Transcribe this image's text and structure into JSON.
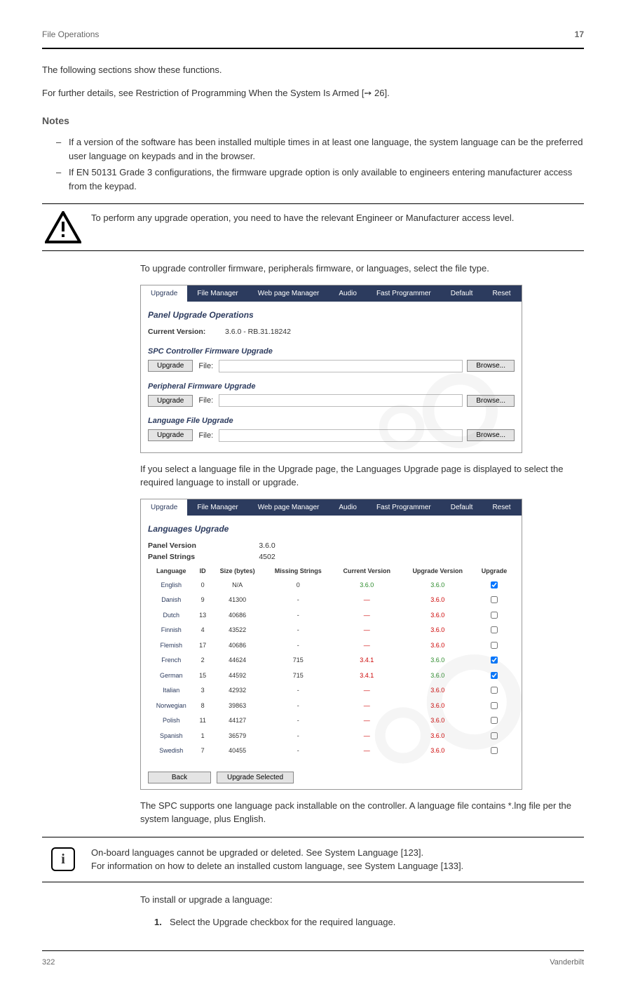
{
  "header": {
    "left": "File Operations",
    "right": "17"
  },
  "footer": {
    "left": "322",
    "right": "Vanderbilt"
  },
  "intro": {
    "line1": "The following sections show these functions.",
    "line2": "For further details, see Restriction of Programming When the System Is Armed [➙ 26]."
  },
  "noteSectionTitle": "Notes",
  "bullets": [
    "If a version of the software has been installed multiple times in at least one language, the system language can be the preferred user language on keypads and in the browser.",
    "If EN 50131 Grade 3 configurations, the firmware upgrade option is only available to engineers entering manufacturer access from the keypad."
  ],
  "warning": "To perform any upgrade operation, you need to have the relevant Engineer or Manufacturer access level.",
  "figure1_intro": "To upgrade controller firmware, peripherals firmware, or languages, select the file type.",
  "figure2_intro": "If you select a language file in the Upgrade page, the Languages Upgrade page is displayed to select the required language to install or upgrade.",
  "fig1": {
    "tabs": [
      "Upgrade",
      "File Manager",
      "Web page Manager",
      "Audio",
      "Fast Programmer",
      "Default",
      "Reset"
    ],
    "title": "Panel Upgrade Operations",
    "current_version_label": "Current Version:",
    "current_version_value": "3.6.0 - RB.31.18242",
    "sections": [
      {
        "title": "SPC Controller Firmware Upgrade",
        "btn": "Upgrade",
        "file": "File:",
        "browse": "Browse..."
      },
      {
        "title": "Peripheral Firmware Upgrade",
        "btn": "Upgrade",
        "file": "File:",
        "browse": "Browse..."
      },
      {
        "title": "Language File Upgrade",
        "btn": "Upgrade",
        "file": "File:",
        "browse": "Browse..."
      }
    ]
  },
  "fig2": {
    "tabs": [
      "Upgrade",
      "File Manager",
      "Web page Manager",
      "Audio",
      "Fast Programmer",
      "Default",
      "Reset"
    ],
    "title": "Languages Upgrade",
    "panel_version_label": "Panel Version",
    "panel_version_value": "3.6.0",
    "panel_strings_label": "Panel Strings",
    "panel_strings_value": "4502",
    "headers": [
      "Language",
      "ID",
      "Size (bytes)",
      "Missing Strings",
      "Current Version",
      "Upgrade Version",
      "Upgrade"
    ],
    "rows": [
      {
        "lang": "English",
        "id": "0",
        "size": "N/A",
        "missing": "0",
        "current": "3.6.0",
        "upgrade": "3.6.0",
        "chk": true,
        "cc": "green",
        "uc": "green"
      },
      {
        "lang": "Danish",
        "id": "9",
        "size": "41300",
        "missing": "-",
        "current": "—",
        "upgrade": "3.6.0",
        "chk": false,
        "cc": "red",
        "uc": "red"
      },
      {
        "lang": "Dutch",
        "id": "13",
        "size": "40686",
        "missing": "-",
        "current": "—",
        "upgrade": "3.6.0",
        "chk": false,
        "cc": "red",
        "uc": "red"
      },
      {
        "lang": "Finnish",
        "id": "4",
        "size": "43522",
        "missing": "-",
        "current": "—",
        "upgrade": "3.6.0",
        "chk": false,
        "cc": "red",
        "uc": "red"
      },
      {
        "lang": "Flemish",
        "id": "17",
        "size": "40686",
        "missing": "-",
        "current": "—",
        "upgrade": "3.6.0",
        "chk": false,
        "cc": "red",
        "uc": "red"
      },
      {
        "lang": "French",
        "id": "2",
        "size": "44624",
        "missing": "715",
        "current": "3.4.1",
        "upgrade": "3.6.0",
        "chk": true,
        "cc": "red",
        "uc": "green"
      },
      {
        "lang": "German",
        "id": "15",
        "size": "44592",
        "missing": "715",
        "current": "3.4.1",
        "upgrade": "3.6.0",
        "chk": true,
        "cc": "red",
        "uc": "green"
      },
      {
        "lang": "Italian",
        "id": "3",
        "size": "42932",
        "missing": "-",
        "current": "—",
        "upgrade": "3.6.0",
        "chk": false,
        "cc": "red",
        "uc": "red"
      },
      {
        "lang": "Norwegian",
        "id": "8",
        "size": "39863",
        "missing": "-",
        "current": "—",
        "upgrade": "3.6.0",
        "chk": false,
        "cc": "red",
        "uc": "red"
      },
      {
        "lang": "Polish",
        "id": "11",
        "size": "44127",
        "missing": "-",
        "current": "—",
        "upgrade": "3.6.0",
        "chk": false,
        "cc": "red",
        "uc": "red"
      },
      {
        "lang": "Spanish",
        "id": "1",
        "size": "36579",
        "missing": "-",
        "current": "—",
        "upgrade": "3.6.0",
        "chk": false,
        "cc": "red",
        "uc": "red"
      },
      {
        "lang": "Swedish",
        "id": "7",
        "size": "40455",
        "missing": "-",
        "current": "—",
        "upgrade": "3.6.0",
        "chk": false,
        "cc": "red",
        "uc": "red"
      }
    ],
    "back_btn": "Back",
    "upgrade_selected_btn": "Upgrade Selected"
  },
  "below2": "The SPC supports one language pack installable on the controller. A language file contains *.lng file per the system language, plus English.",
  "infoNote": {
    "line1": "On-board languages cannot be upgraded or deleted. See System Language [123].",
    "line2": "For information on how to delete an installed custom language, see System Language [133]."
  },
  "steps_intro": "To install or upgrade a language:",
  "steps": [
    "Select the Upgrade checkbox for the required language."
  ]
}
